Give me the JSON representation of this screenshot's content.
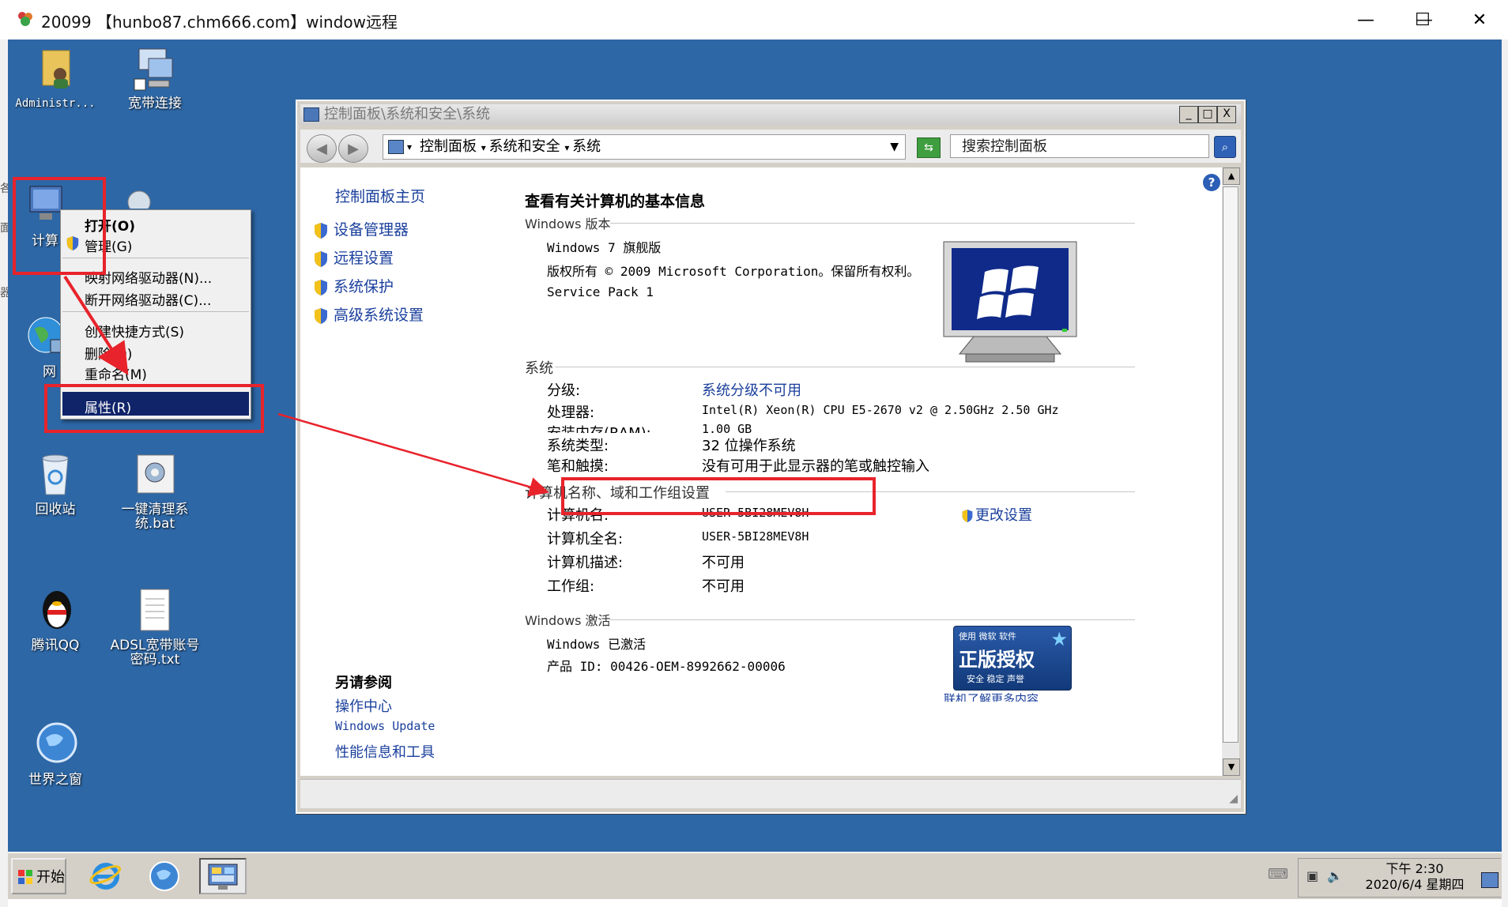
{
  "window": {
    "title": "20099 【hunbo87.chm666.com】window远程",
    "controls": {
      "minimize": "—",
      "maximize": "☐",
      "close": "✕"
    }
  },
  "desktop": {
    "icons": [
      {
        "name": "administrator-folder",
        "label": "Administr..."
      },
      {
        "name": "broadband",
        "label": "宽带连接"
      },
      {
        "name": "computer",
        "label": "计算"
      },
      {
        "name": "network",
        "label": "网"
      },
      {
        "name": "recycle-bin",
        "label": "回收站"
      },
      {
        "name": "cleanup-bat",
        "label": "一键清理系\n统.bat"
      },
      {
        "name": "qq",
        "label": "腾讯QQ"
      },
      {
        "name": "adsl-txt",
        "label": "ADSL宽带账号\n密码.txt"
      },
      {
        "name": "world-window",
        "label": "世界之窗"
      }
    ],
    "left_edge_chars": [
      "各",
      "面",
      "器"
    ]
  },
  "context_menu": {
    "items": [
      {
        "label": "打开(O)",
        "bold": true
      },
      {
        "label": "管理(G)"
      },
      {
        "label": "映射网络驱动器(N)..."
      },
      {
        "label": "断开网络驱动器(C)..."
      },
      {
        "label": "创建快捷方式(S)"
      },
      {
        "label": "删除(D)"
      },
      {
        "label": "重命名(M)"
      },
      {
        "label": "属性(R)",
        "selected": true
      }
    ]
  },
  "control_panel": {
    "title": "控制面板\\系统和安全\\系统",
    "title_buttons": {
      "min": "_",
      "max": "□",
      "close": "X"
    },
    "address": [
      "控制面板",
      "系统和安全",
      "系统"
    ],
    "search_placeholder": "搜索控制面板",
    "left_nav": {
      "home": "控制面板主页",
      "links": [
        "设备管理器",
        "远程设置",
        "系统保护",
        "高级系统设置"
      ],
      "see_also_title": "另请参阅",
      "see_also": [
        "操作中心",
        "Windows Update",
        "性能信息和工具"
      ]
    },
    "main_title": "查看有关计算机的基本信息",
    "edition": {
      "section": "Windows 版本",
      "name": "Windows 7 旗舰版",
      "copyright": "版权所有 © 2009 Microsoft Corporation。保留所有权利。",
      "service_pack": "Service Pack 1"
    },
    "system": {
      "section": "系统",
      "rows": [
        {
          "label": "分级:",
          "value": "系统分级不可用",
          "link": true
        },
        {
          "label": "处理器:",
          "value": "Intel(R) Xeon(R) CPU E5-2670 v2 @ 2.50GHz   2.50 GHz"
        },
        {
          "label": "安装内存(RAM):",
          "value": "1.00 GB"
        },
        {
          "label": "系统类型:",
          "value": "32 位操作系统"
        },
        {
          "label": "笔和触摸:",
          "value": "没有可用于此显示器的笔或触控输入"
        }
      ]
    },
    "computer_name": {
      "section": "计算机名称、域和工作组设置",
      "change_link": "更改设置",
      "rows": [
        {
          "label": "计算机名:",
          "value": "USER-5BI28MEV8H"
        },
        {
          "label": "计算机全名:",
          "value": "USER-5BI28MEV8H"
        },
        {
          "label": "计算机描述:",
          "value": "不可用"
        },
        {
          "label": "工作组:",
          "value": "不可用"
        }
      ]
    },
    "activation": {
      "section": "Windows 激活",
      "status": "Windows 已激活",
      "product_id": "产品 ID: 00426-OEM-8992662-00006",
      "badge_top": "使用 微软 软件",
      "badge_main": "正版授权",
      "badge_sub": "安全 稳定 声誉",
      "learn_more": "联机了解更多内容..."
    }
  },
  "taskbar": {
    "start_label": "开始",
    "clock_time": "下午 2:30",
    "clock_date": "2020/6/4 星期四"
  },
  "colors": {
    "desktop": "#2d67a6",
    "annotation": "#e8232b",
    "link": "#1a3f9c",
    "menu_selected": "#10246a"
  }
}
